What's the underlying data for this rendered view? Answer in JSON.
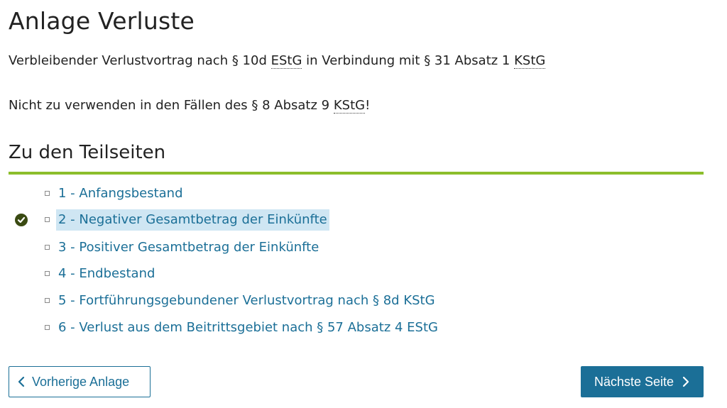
{
  "page": {
    "title": "Anlage Verluste",
    "intro_prefix": "Verbleibender Verlustvortrag nach § 10d ",
    "intro_abbr1": "EStG",
    "intro_middle": " in Verbindung mit § 31 Absatz 1 ",
    "intro_abbr2": "KStG",
    "note_prefix": "Nicht zu verwenden in den Fällen des § 8 Absatz 9 ",
    "note_abbr": "KStG",
    "note_suffix": "!"
  },
  "subpages": {
    "heading": "Zu den Teilseiten",
    "items": [
      {
        "label": "1 - Anfangsbestand",
        "done": false,
        "active": false
      },
      {
        "label": "2 - Negativer Gesamtbetrag der Einkünfte",
        "done": true,
        "active": true
      },
      {
        "label": "3 - Positiver Gesamtbetrag der Einkünfte",
        "done": false,
        "active": false
      },
      {
        "label": "4 - Endbestand",
        "done": false,
        "active": false
      },
      {
        "label": "5 - Fortführungsgebundener Verlustvortrag nach § 8d KStG",
        "done": false,
        "active": false
      },
      {
        "label": "6 - Verlust aus dem Beitrittsgebiet nach § 57 Absatz 4 EStG",
        "done": false,
        "active": false
      }
    ]
  },
  "nav": {
    "prev_label": "Vorherige Anlage",
    "next_label": "Nächste Seite"
  },
  "colors": {
    "accent_green": "#8cbe2c",
    "link_blue": "#1b6f97",
    "active_bg": "#cfe6f3",
    "check_dark": "#3a4a12"
  }
}
